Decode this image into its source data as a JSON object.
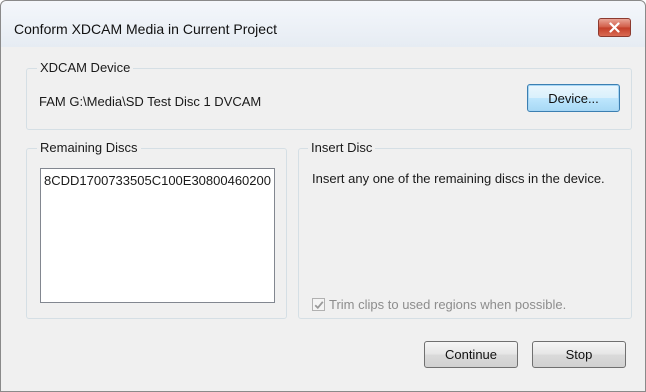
{
  "window": {
    "title": "Conform XDCAM Media in Current Project"
  },
  "device_group": {
    "label": "XDCAM Device",
    "path": "FAM G:\\Media\\SD Test Disc 1 DVCAM",
    "device_button": "Device..."
  },
  "remaining_group": {
    "label": "Remaining Discs",
    "items": [
      "8CDD1700733505C100E30800460200"
    ]
  },
  "insert_group": {
    "label": "Insert Disc",
    "instruction": "Insert any one of the remaining discs in the device.",
    "trim_checkbox": {
      "label": "Trim clips to used regions when possible.",
      "checked": true,
      "disabled": true
    }
  },
  "buttons": {
    "continue": "Continue",
    "stop": "Stop"
  },
  "icons": {
    "close": "close-icon",
    "check": "checkmark-icon"
  },
  "colors": {
    "close_button": "#c94a35",
    "default_button_border": "#3c7fb1"
  }
}
